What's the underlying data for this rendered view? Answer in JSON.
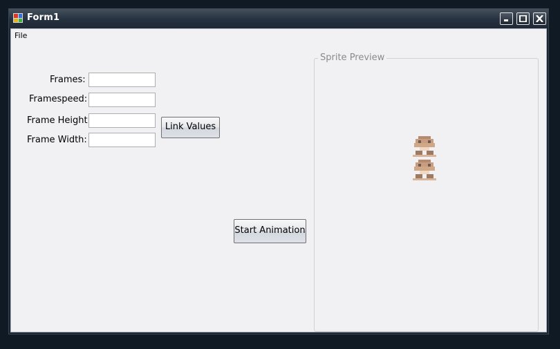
{
  "window": {
    "title": "Form1"
  },
  "menu": {
    "file_label": "File"
  },
  "fields": {
    "frames_label": "Frames:",
    "framespeed_label": "Framespeed:",
    "frame_height_label": "Frame Height:",
    "frame_width_label": "Frame Width:",
    "frames_value": "",
    "framespeed_value": "",
    "frame_height_value": "",
    "frame_width_value": ""
  },
  "buttons": {
    "link_values": "Link Values",
    "start_animation": "Start Animation"
  },
  "preview": {
    "title": "Sprite Preview",
    "sprite_icon": "goomba-sprite-icon"
  },
  "title_buttons": {
    "minimize_icon": "minimize-icon",
    "maximize_icon": "maximize-icon",
    "close_icon": "close-icon"
  }
}
